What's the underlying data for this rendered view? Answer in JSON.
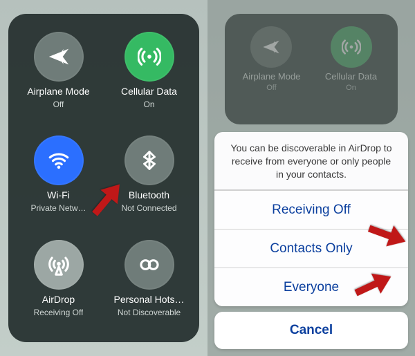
{
  "left_panel": {
    "tiles": [
      {
        "id": "airplane",
        "label": "Airplane Mode",
        "sub": "Off",
        "circle": "grey"
      },
      {
        "id": "cellular",
        "label": "Cellular Data",
        "sub": "On",
        "circle": "green"
      },
      {
        "id": "wifi",
        "label": "Wi-Fi",
        "sub": "Private Netw…",
        "circle": "blue"
      },
      {
        "id": "bluetooth",
        "label": "Bluetooth",
        "sub": "Not Connected",
        "circle": "grey"
      },
      {
        "id": "airdrop",
        "label": "AirDrop",
        "sub": "Receiving Off",
        "circle": "grey-light"
      },
      {
        "id": "hotspot",
        "label": "Personal Hots…",
        "sub": "Not Discoverable",
        "circle": "grey"
      }
    ]
  },
  "right_panel": {
    "mini_tiles": [
      {
        "id": "airplane",
        "label": "Airplane Mode",
        "sub": "Off",
        "circle": "grey"
      },
      {
        "id": "cellular",
        "label": "Cellular Data",
        "sub": "On",
        "circle": "green"
      }
    ],
    "sheet": {
      "message": "You can be discoverable in AirDrop to receive from everyone or only people in your contacts.",
      "options": [
        "Receiving Off",
        "Contacts Only",
        "Everyone"
      ],
      "cancel": "Cancel"
    }
  }
}
